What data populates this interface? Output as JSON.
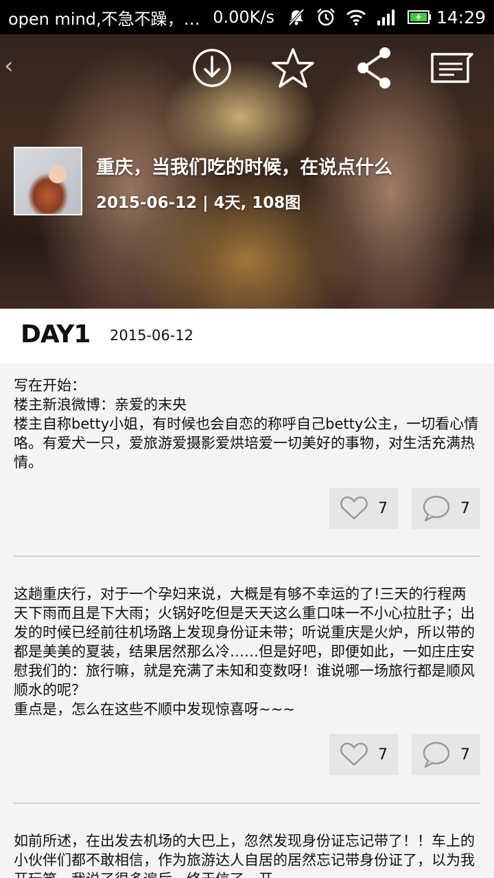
{
  "status_bar": {
    "notification": "open mind,不急不躁，…",
    "speed": "0.00K/s",
    "time": "14:29",
    "icons": [
      "mute-icon",
      "alarm-icon",
      "wifi-icon",
      "signal-icon",
      "battery-icon"
    ]
  },
  "hero": {
    "back_glyph": "‹",
    "actions": [
      "download-icon",
      "star-icon",
      "share-icon",
      "comments-icon"
    ],
    "title": "重庆，当我们吃的时候，在说点什么",
    "meta": "2015-06-12 | 4天, 108图"
  },
  "day": {
    "label": "DAY1",
    "date": "2015-06-12"
  },
  "posts": [
    {
      "text": "写在开始：\n楼主新浪微博：亲爱的末央\n楼主自称betty小姐，有时候也会自恋的称呼自己betty公主，一切看心情咯。有爱犬一只，爱旅游爱摄影爱烘培爱一切美好的事物，对生活充满热情。",
      "likes": "7",
      "comments": "7"
    },
    {
      "text": "这趟重庆行，对于一个孕妇来说，大概是有够不幸运的了!三天的行程两天下雨而且是下大雨；火锅好吃但是天天这么重口味一不小心拉肚子；出发的时候已经前往机场路上发现身份证未带；听说重庆是火炉，所以带的都是美美的夏装，结果居然那么冷……但是好吧，即便如此，一如庄庄安慰我们的：旅行嘛，就是充满了未知和变数呀！谁说哪一场旅行都是顺风顺水的呢？\n重点是，怎么在这些不顺中发现惊喜呀~~~",
      "likes": "7",
      "comments": "7"
    },
    {
      "text": "如前所述，在出发去机场的大巴上，忽然发现身份证忘记带了！！车上的小伙伴们都不敢相信，作为旅游达人自居的居然忘记带身份证了，以为我开玩笑，我说了很多遍后，终于信了。开"
    }
  ],
  "colors": {
    "status_bg": "#000000",
    "page_bg": "#f4f4f4",
    "pill_bg": "#e6e6e6",
    "battery_green": "#3bd13b"
  }
}
